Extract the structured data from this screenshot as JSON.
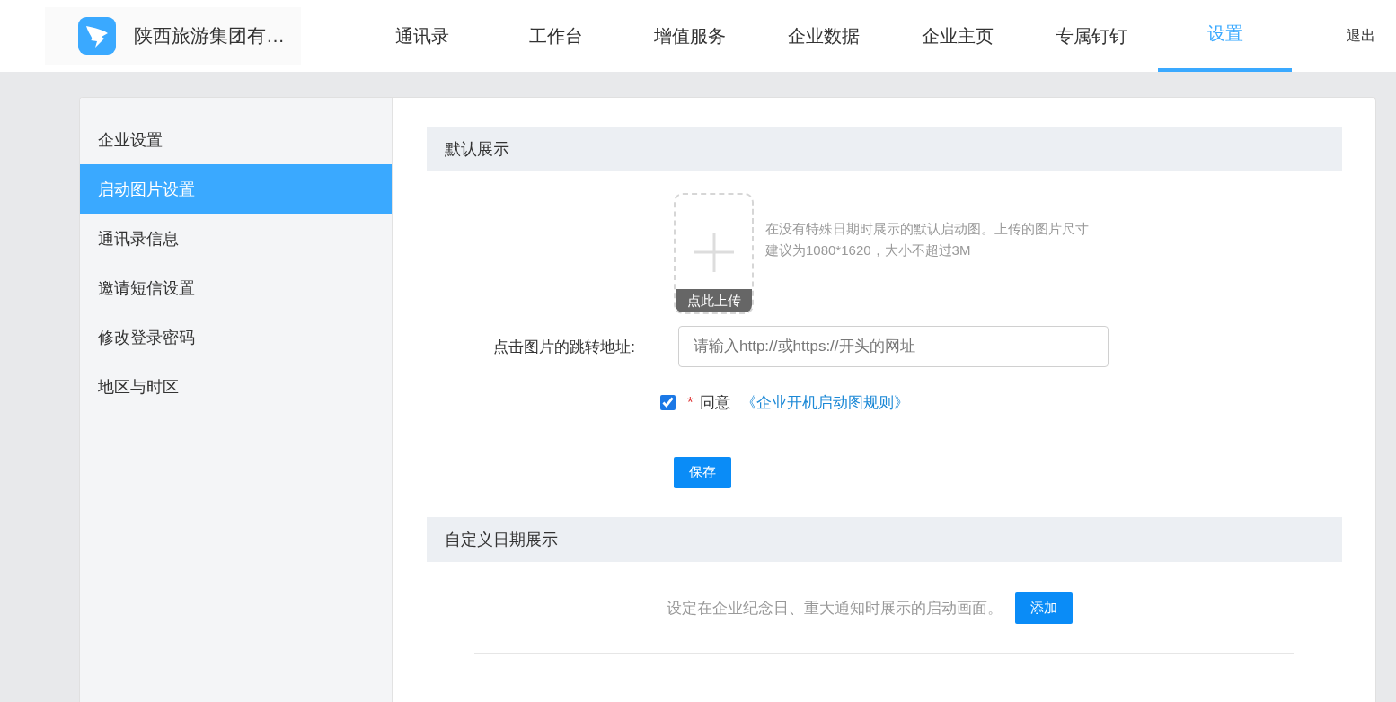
{
  "header": {
    "org_name": "陕西旅游集团有…",
    "nav": [
      {
        "label": "通讯录",
        "selected": false
      },
      {
        "label": "工作台",
        "selected": false
      },
      {
        "label": "增值服务",
        "selected": false
      },
      {
        "label": "企业数据",
        "selected": false
      },
      {
        "label": "企业主页",
        "selected": false
      },
      {
        "label": "专属钉钉",
        "selected": false
      },
      {
        "label": "设置",
        "selected": true
      }
    ],
    "logout": "退出"
  },
  "sidebar": {
    "items": [
      {
        "label": "企业设置",
        "selected": false
      },
      {
        "label": "启动图片设置",
        "selected": true
      },
      {
        "label": "通讯录信息",
        "selected": false
      },
      {
        "label": "邀请短信设置",
        "selected": false
      },
      {
        "label": "修改登录密码",
        "selected": false
      },
      {
        "label": "地区与时区",
        "selected": false
      }
    ]
  },
  "default_section": {
    "title": "默认展示",
    "upload_label": "点此上传",
    "hint": "在没有特殊日期时展示的默认启动图。上传的图片尺寸建议为1080*1620，大小不超过3M",
    "url_label": "点击图片的跳转地址:",
    "url_placeholder": "请输入http://或https://开头的网址",
    "agree": {
      "checked": true,
      "required_mark": "*",
      "label": "同意",
      "link": "《企业开机启动图规则》"
    },
    "save_button": "保存"
  },
  "custom_section": {
    "title": "自定义日期展示",
    "description": "设定在企业纪念日、重大通知时展示的启动画面。",
    "add_button": "添加"
  }
}
